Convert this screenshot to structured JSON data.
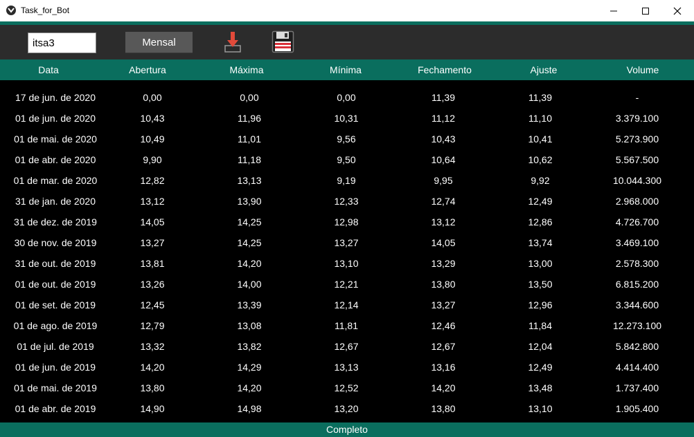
{
  "window": {
    "title": "Task_for_Bot"
  },
  "toolbar": {
    "ticker_value": "itsa3",
    "period_label": "Mensal",
    "download_icon": "download-icon",
    "save_icon": "floppy-disk-icon"
  },
  "columns": [
    "Data",
    "Abertura",
    "Máxima",
    "Mínima",
    "Fechamento",
    "Ajuste",
    "Volume"
  ],
  "rows": [
    [
      "17 de jun. de 2020",
      "0,00",
      "0,00",
      "0,00",
      "11,39",
      "11,39",
      "-"
    ],
    [
      "01 de jun. de 2020",
      "10,43",
      "11,96",
      "10,31",
      "11,12",
      "11,10",
      "3.379.100"
    ],
    [
      "01 de mai. de 2020",
      "10,49",
      "11,01",
      "9,56",
      "10,43",
      "10,41",
      "5.273.900"
    ],
    [
      "01 de abr. de 2020",
      "9,90",
      "11,18",
      "9,50",
      "10,64",
      "10,62",
      "5.567.500"
    ],
    [
      "01 de mar. de 2020",
      "12,82",
      "13,13",
      "9,19",
      "9,95",
      "9,92",
      "10.044.300"
    ],
    [
      "31 de jan. de 2020",
      "13,12",
      "13,90",
      "12,33",
      "12,74",
      "12,49",
      "2.968.000"
    ],
    [
      "31 de dez. de 2019",
      "14,05",
      "14,25",
      "12,98",
      "13,12",
      "12,86",
      "4.726.700"
    ],
    [
      "30 de nov. de 2019",
      "13,27",
      "14,25",
      "13,27",
      "14,05",
      "13,74",
      "3.469.100"
    ],
    [
      "31 de out. de 2019",
      "13,81",
      "14,20",
      "13,10",
      "13,29",
      "13,00",
      "2.578.300"
    ],
    [
      "01 de out. de 2019",
      "13,26",
      "14,00",
      "12,21",
      "13,80",
      "13,50",
      "6.815.200"
    ],
    [
      "01 de set. de 2019",
      "12,45",
      "13,39",
      "12,14",
      "13,27",
      "12,96",
      "3.344.600"
    ],
    [
      "01 de ago. de 2019",
      "12,79",
      "13,08",
      "11,81",
      "12,46",
      "11,84",
      "12.273.100"
    ],
    [
      "01 de jul. de 2019",
      "13,32",
      "13,82",
      "12,67",
      "12,67",
      "12,04",
      "5.842.800"
    ],
    [
      "01 de jun. de 2019",
      "14,20",
      "14,29",
      "13,13",
      "13,16",
      "12,49",
      "4.414.400"
    ],
    [
      "01 de mai. de 2019",
      "13,80",
      "14,20",
      "12,52",
      "14,20",
      "13,48",
      "1.737.400"
    ],
    [
      "01 de abr. de 2019",
      "14,90",
      "14,98",
      "13,20",
      "13,80",
      "13,10",
      "1.905.400"
    ]
  ],
  "status": {
    "text": "Completo"
  },
  "colors": {
    "accent": "#0a6e5e",
    "toolbar": "#2c2c2c",
    "table_bg": "#000000"
  }
}
